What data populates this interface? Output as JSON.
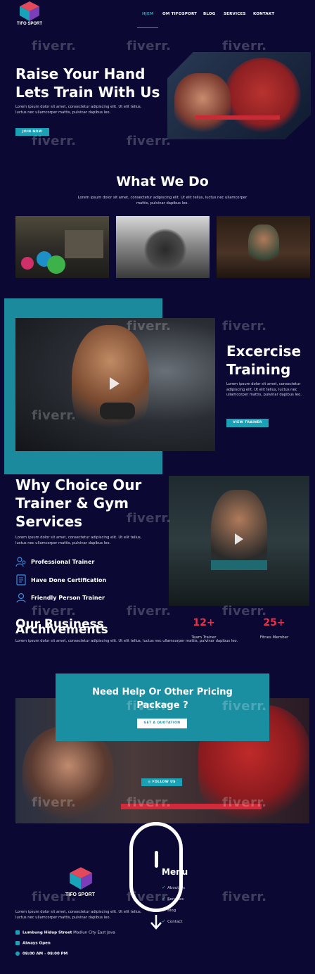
{
  "brand": {
    "name": "TIFO SPORT"
  },
  "nav": {
    "items": [
      {
        "label": "HJEM"
      },
      {
        "label": "OM TIFOSPORT"
      },
      {
        "label": "BLOG"
      },
      {
        "label": "SERVICES"
      },
      {
        "label": "KONTAKT"
      }
    ]
  },
  "hero": {
    "title_line1": "Raise Your Hand",
    "title_line2": "Lets Train With Us",
    "text": "Lorem ipsum dolor sit amet, consectetur adipiscing elit. Ut elit tellus, luctus nec ullamcorper mattis, pulvinar dapibus leo.",
    "button": "JOIN NOW"
  },
  "whatwedo": {
    "title": "What We Do",
    "text": "Lorem ipsum dolor sit amet, consectetur adipiscing elit. Ut elit tellus, luctus nec ullamcorper mattis, pulvinar dapibus leo."
  },
  "exercise": {
    "title_line1": "Excercise",
    "title_line2": "Training",
    "text": "Lorem ipsum dolor sit amet, consectetur adipiscing elit. Ut elit tellus, luctus nec ullamcorper mattis, pulvinar dapibus leo.",
    "button": "VIEW TRAINER"
  },
  "why": {
    "title_line1": "Why Choice Our",
    "title_line2": "Trainer & Gym",
    "title_line3": "Services",
    "text": "Lorem ipsum dolor sit amet, consectetur adipiscing elit. Ut elit tellus, luctus nec ullamcorper mattis, pulvinar dapibus leo.",
    "features": [
      {
        "label": "Professional Trainer",
        "icon": "trainer-icon"
      },
      {
        "label": "Have Done Certification",
        "icon": "certificate-icon"
      },
      {
        "label": "Friendly Person Trainer",
        "icon": "friendly-person-icon"
      }
    ]
  },
  "achievements": {
    "title_a": "Our Business",
    "title_b": "Archivements",
    "text": "Lorem ipsum dolor sit amet, consectetur adipiscing elit. Ut elit tellus, luctus nec ullamcorper mattis, pulvinar dapibus leo.",
    "stats": [
      {
        "value": "12+",
        "label": "Team Trainer"
      },
      {
        "value": "25+",
        "label": "Fitnes Member"
      }
    ]
  },
  "pricing": {
    "title_line1": "Need Help Or Other Pricing",
    "title_line2": "Package ?",
    "button": "GET A QUOTATION"
  },
  "follow": {
    "button": "FOLLOW US"
  },
  "footer": {
    "brand": "TIFO SPORT",
    "text": "Lorem ipsum dolor sit amet, consectetur adipiscing elit. Ut elit tellus, luctus nec ullamcorper mattis, pulvinar dapibus leo.",
    "address": "Lumbung Hidup Street",
    "address_city": "Madiun City East Java",
    "open": "Always Open",
    "hours": "08:00 AM - 08:00 PM",
    "menu_title": "Menu",
    "menu_items": [
      "About Us",
      "Services",
      "Blog",
      "Contact"
    ]
  },
  "watermark": "fiverr.",
  "colors": {
    "background": "#0b0833",
    "accent": "#19a3b8",
    "stat": "#e8304a"
  }
}
